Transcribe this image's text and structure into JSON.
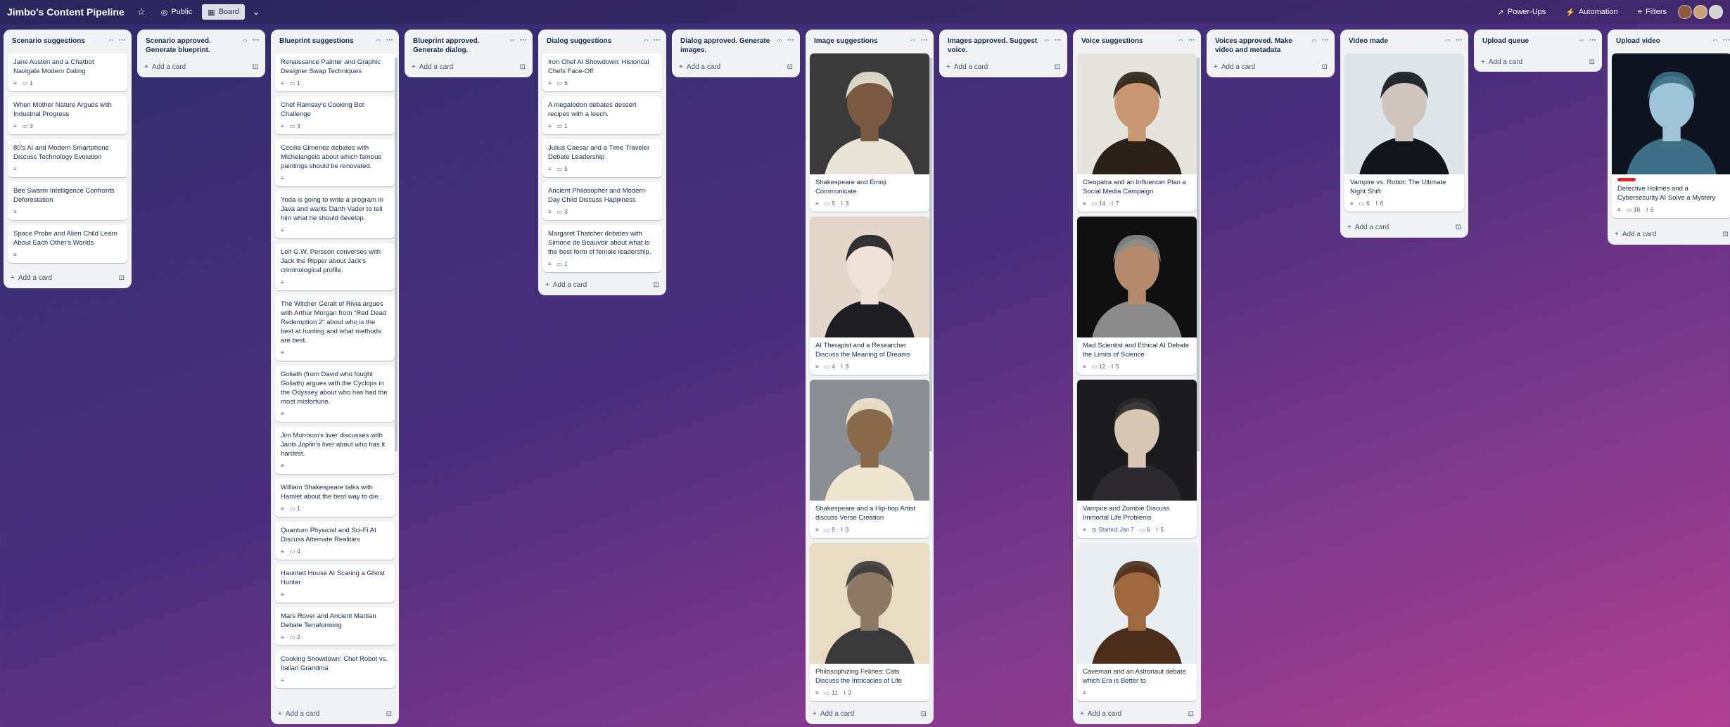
{
  "board": {
    "title": "Jimbo's Content Pipeline",
    "visibility": "Public",
    "view": "Board"
  },
  "topbar": {
    "powerups": "Power-Ups",
    "automation": "Automation",
    "filters": "Filters"
  },
  "icons": {
    "star": "star-icon",
    "globe": "globe-icon",
    "board": "board-icon",
    "chevron": "chevron-down-icon",
    "rocket": "rocket-icon",
    "bolt": "bolt-icon",
    "filter": "filter-icon",
    "collapse": "collapse-icon",
    "more": "more-icon",
    "plus": "plus-icon",
    "template": "template-icon",
    "description": "description-icon",
    "comment": "comment-icon",
    "attachment": "attachment-icon",
    "clock": "clock-icon"
  },
  "add_card_label": "Add a card",
  "lists": [
    {
      "title": "Scenario suggestions",
      "cards": [
        {
          "title": "Jane Austen and a Chatbot Navigate Modern Dating",
          "comments": "1"
        },
        {
          "title": "When Mother Nature Argues with Industrial Progress",
          "comments": "3"
        },
        {
          "title": "80's AI and Modern Smartphone Discuss Technology Evolution"
        },
        {
          "title": "Bee Swarm Intelligence Confronts Deforestation"
        },
        {
          "title": "Space Probe and Alien Child Learn About Each Other's Worlds"
        }
      ]
    },
    {
      "title": "Scenario approved. Generate blueprint.",
      "cards": []
    },
    {
      "title": "Blueprint suggestions",
      "cards": [
        {
          "title": "Renaissance Painter and Graphic Designer Swap Techniques",
          "comments": "1"
        },
        {
          "title": "Chef Ramsay's Cooking Bot Challenge",
          "comments": "3"
        },
        {
          "title": "Cecilia Gimenez debates with Michelangelo about which famous paintings should be renovated."
        },
        {
          "title": "Yoda is going to write a program in Java and wants Darth Vader to tell him what he should develop."
        },
        {
          "title": "Leif G.W. Persson converses with Jack the Ripper about Jack's criminological profile."
        },
        {
          "title": "The Witcher Geralt of Rivia argues with Arthur Morgan from \"Red Dead Redemption 2\" about who is the best at hunting and what methods are best."
        },
        {
          "title": "Goliath (from David who fought Goliath) argues with the Cyclops in the Odyssey about who has had the most misfortune."
        },
        {
          "title": "Jim Morrison's liver discusses with Janis Joplin's liver about who has it hardest."
        },
        {
          "title": "William Shakespeare talks with Hamlet about the best way to die.",
          "comments": "1"
        },
        {
          "title": "Quantum Physicist and Sci-Fi AI Discuss Alternate Realities",
          "comments": "4"
        },
        {
          "title": "Haunted House AI Scaring a Ghost Hunter"
        },
        {
          "title": "Mars Rover and Ancient Martian Debate Terraforming",
          "comments": "2"
        },
        {
          "title": "Cooking Showdown: Chef Robot vs. Italian Grandma"
        }
      ]
    },
    {
      "title": "Blueprint approved. Generate dialog.",
      "cards": []
    },
    {
      "title": "Dialog suggestions",
      "cards": [
        {
          "title": "Iron Chef AI Showdown: Historical Chefs Face-Off",
          "comments": "6"
        },
        {
          "title": "A megalodon debates dessert recipes with a leech.",
          "comments": "1"
        },
        {
          "title": "Julius Caesar and a Time Traveler Debate Leadership",
          "comments": "5"
        },
        {
          "title": "Ancient Philosopher and Modern-Day Child Discuss Happiness",
          "comments": "3"
        },
        {
          "title": "Margaret Thatcher debates with Simone de Beauvoir about what is the best form of female leadership.",
          "comments": "1"
        }
      ]
    },
    {
      "title": "Dialog approved. Generate images.",
      "cards": []
    },
    {
      "title": "Image suggestions",
      "cards": [
        {
          "title": "Shakespeare and Emoji Communicate",
          "comments": "5",
          "attachments": "3"
        },
        {
          "title": "AI Therapist and a Researcher Discuss the Meaning of Dreams",
          "comments": "4",
          "attachments": "3"
        },
        {
          "title": "Shakespeare and a Hip-hop Artist discuss Verse Creation",
          "comments": "9",
          "attachments": "3"
        },
        {
          "title": "Philosophizing Felines: Cats Discuss the Intricacies of Life",
          "comments": "11",
          "attachments": "3"
        }
      ]
    },
    {
      "title": "Images approved. Suggest voice.",
      "cards": []
    },
    {
      "title": "Voice suggestions",
      "cards": [
        {
          "title": "Cleopatra and an Influencer Plan a Social Media Campaign",
          "comments": "14",
          "attachments": "7"
        },
        {
          "title": "Mad Scientist and Ethical AI Debate the Limits of Science",
          "comments": "12",
          "attachments": "5"
        },
        {
          "title": "Vampire and Zombie Discuss Immortal Life Problems",
          "date": "Started: Jan 7",
          "comments": "6",
          "attachments": "5"
        },
        {
          "title": "Caveman and an Astronaut debate which Era is Better to"
        }
      ]
    },
    {
      "title": "Voices approved. Make video and metadata",
      "cards": []
    },
    {
      "title": "Video made",
      "cards": [
        {
          "title": "Vampire vs. Robot: The Ultimate Night Shift",
          "comments": "6",
          "attachments": "6"
        }
      ]
    },
    {
      "title": "Upload queue",
      "cards": []
    },
    {
      "title": "Upload video",
      "cards": [
        {
          "title": "Detective Holmes and a Cybersecurity AI Solve a Mystery",
          "comments": "18",
          "attachments": "6"
        }
      ]
    }
  ]
}
